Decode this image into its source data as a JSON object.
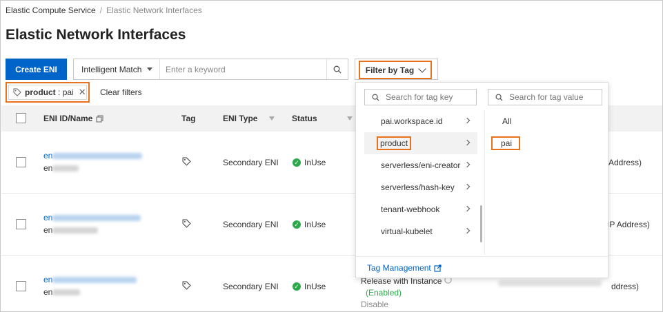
{
  "breadcrumb": {
    "root": "Elastic Compute Service",
    "separator": "/",
    "current": "Elastic Network Interfaces"
  },
  "page": {
    "title": "Elastic Network Interfaces"
  },
  "toolbar": {
    "create_label": "Create ENI",
    "match_label": "Intelligent Match",
    "keyword_placeholder": "Enter a keyword",
    "filter_by_tag_label": "Filter by Tag"
  },
  "active_filter": {
    "key": "product",
    "separator": " : ",
    "value": "pai",
    "clear_label": "Clear filters"
  },
  "table": {
    "columns": {
      "id_name": "ENI ID/Name",
      "tag": "Tag",
      "type": "ENI Type",
      "status": "Status"
    },
    "rows": [
      {
        "id_prefix": "en",
        "name_prefix": "en",
        "type": "Secondary ENI",
        "status": "InUse",
        "ip_suffix": "Address)"
      },
      {
        "id_prefix": "en",
        "name_prefix": "en",
        "type": "Secondary ENI",
        "status": "InUse",
        "ip_suffix": "IP Address)"
      },
      {
        "id_prefix": "en",
        "name_prefix": "en",
        "type": "Secondary ENI",
        "status": "InUse",
        "ip_suffix": "ddress)",
        "release_label": "Release with Instance",
        "enabled_label": "(Enabled)",
        "disable_label": "Disable"
      }
    ]
  },
  "tag_dropdown": {
    "key_search_placeholder": "Search for tag key",
    "value_search_placeholder": "Search for tag value",
    "keys": [
      "pai.workspace.id",
      "product",
      "serverless/eni-creator",
      "serverless/hash-key",
      "tenant-webhook",
      "virtual-kubelet"
    ],
    "selected_key_index": 1,
    "values": [
      "All",
      "pai"
    ],
    "selected_value_index": 1,
    "footer_link": "Tag Management"
  },
  "colors": {
    "primary": "#0064c8",
    "highlight": "#e8711c",
    "ok": "#2aa84a"
  }
}
